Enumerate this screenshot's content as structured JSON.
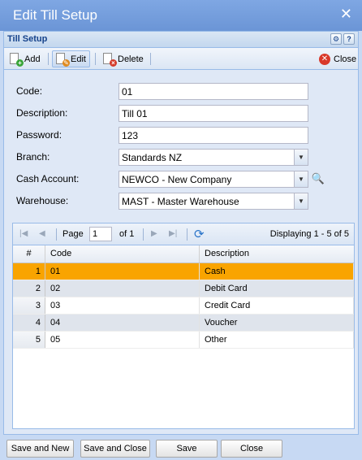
{
  "window": {
    "title": "Edit Till Setup"
  },
  "panel": {
    "title": "Till Setup"
  },
  "toolbar": {
    "add": "Add",
    "edit": "Edit",
    "delete": "Delete",
    "close": "Close"
  },
  "form": {
    "code_label": "Code:",
    "code_value": "01",
    "description_label": "Description:",
    "description_value": "Till 01",
    "password_label": "Password:",
    "password_value": "123",
    "branch_label": "Branch:",
    "branch_value": "Standards NZ",
    "cash_account_label": "Cash Account:",
    "cash_account_value": "NEWCO - New Company",
    "warehouse_label": "Warehouse:",
    "warehouse_value": "MAST - Master Warehouse"
  },
  "pager": {
    "page_label": "Page",
    "page_value": "1",
    "of_label": "of 1",
    "display": "Displaying 1 - 5 of 5"
  },
  "grid": {
    "headers": {
      "num": "#",
      "code": "Code",
      "description": "Description"
    },
    "rows": [
      {
        "num": "1",
        "code": "01",
        "description": "Cash"
      },
      {
        "num": "2",
        "code": "02",
        "description": "Debit Card"
      },
      {
        "num": "3",
        "code": "03",
        "description": "Credit Card"
      },
      {
        "num": "4",
        "code": "04",
        "description": "Voucher"
      },
      {
        "num": "5",
        "code": "05",
        "description": "Other"
      }
    ]
  },
  "footer": {
    "save_new": "Save and New",
    "save_close": "Save and Close",
    "save": "Save",
    "close": "Close"
  },
  "colors": {
    "selected_row": "#f9a400",
    "titlebar": "#7fa7e3",
    "panel_bg": "#dfe8f6"
  },
  "icons": {
    "window_close": "close-x-icon",
    "add": "add-document-icon",
    "edit": "edit-document-icon",
    "delete": "delete-document-icon",
    "close": "close-circle-icon",
    "search": "magnifier-icon",
    "refresh": "refresh-icon"
  }
}
